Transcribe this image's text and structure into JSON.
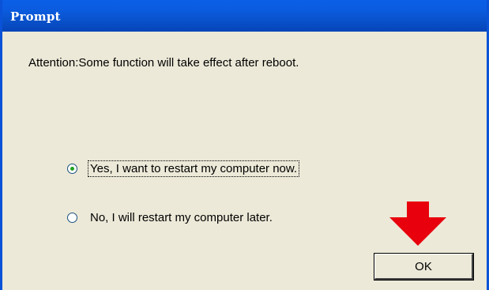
{
  "dialog": {
    "title": "Prompt",
    "message": "Attention:Some function will take effect after reboot.",
    "options": [
      {
        "label": "Yes, I want to restart my computer now.",
        "selected": true
      },
      {
        "label": "No, I will restart my computer later.",
        "selected": false
      }
    ],
    "ok_label": "OK"
  },
  "colors": {
    "titlebar": "#0a5fe6",
    "window_background": "#ece9d8",
    "arrow": "#e8000c"
  },
  "icons": {
    "annotation_arrow": "arrow-down-icon"
  }
}
